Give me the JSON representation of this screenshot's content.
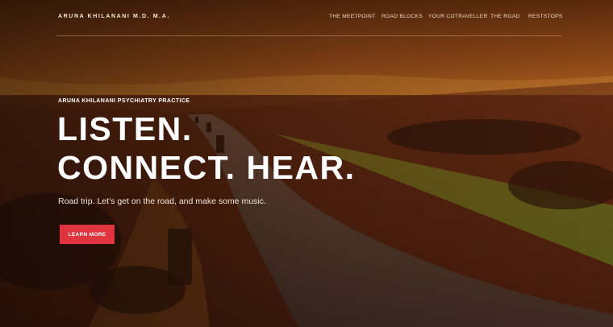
{
  "brand": "ARUNA KHILANANI M.D. M.A.",
  "nav": {
    "items": [
      {
        "label": "THE MEETPOINT"
      },
      {
        "label": "ROAD BLOCKS"
      },
      {
        "label": "YOUR COTRAVELLER"
      },
      {
        "label": "THE ROAD"
      },
      {
        "label": "RESTSTOPS"
      }
    ]
  },
  "hero": {
    "kicker": "ARUNA KHILANANI PSYCHIATRY PRACTICE",
    "headline_line1": "LISTEN.",
    "headline_line2": "CONNECT. HEAR.",
    "subtext": "Road trip. Let’s get on the road, and make some music.",
    "cta_label": "LEARN MORE"
  },
  "colors": {
    "accent": "#e0353f",
    "sky": "#7a3a12",
    "land": "#4a200c"
  },
  "background_image": "sunset-road-photo"
}
